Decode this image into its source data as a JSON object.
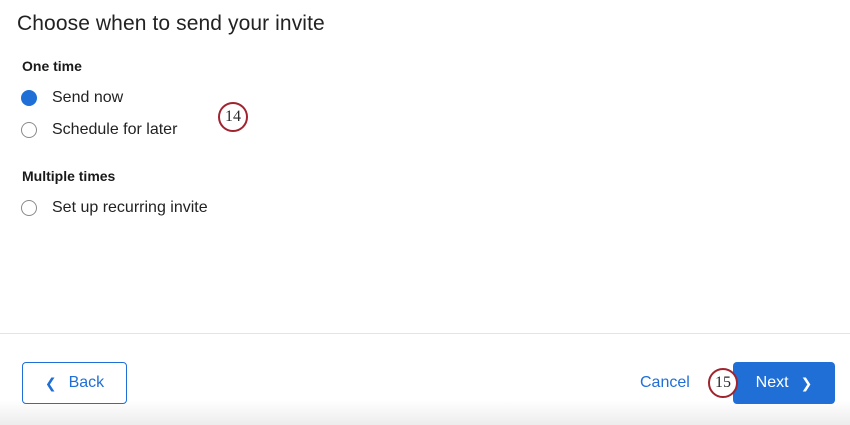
{
  "title": "Choose when to send your invite",
  "sections": [
    {
      "label": "One time",
      "options": [
        {
          "label": "Send now",
          "checked": true
        },
        {
          "label": "Schedule for later",
          "checked": false
        }
      ]
    },
    {
      "label": "Multiple times",
      "options": [
        {
          "label": "Set up recurring invite",
          "checked": false
        }
      ]
    }
  ],
  "markers": {
    "m14": "14",
    "m15": "15"
  },
  "footer": {
    "back_label": "Back",
    "cancel_label": "Cancel",
    "next_label": "Next",
    "back_icon": "chevron-left-icon",
    "next_icon": "chevron-right-icon"
  },
  "colors": {
    "accent": "#1f6fd6",
    "marker_border": "#a0242f"
  }
}
